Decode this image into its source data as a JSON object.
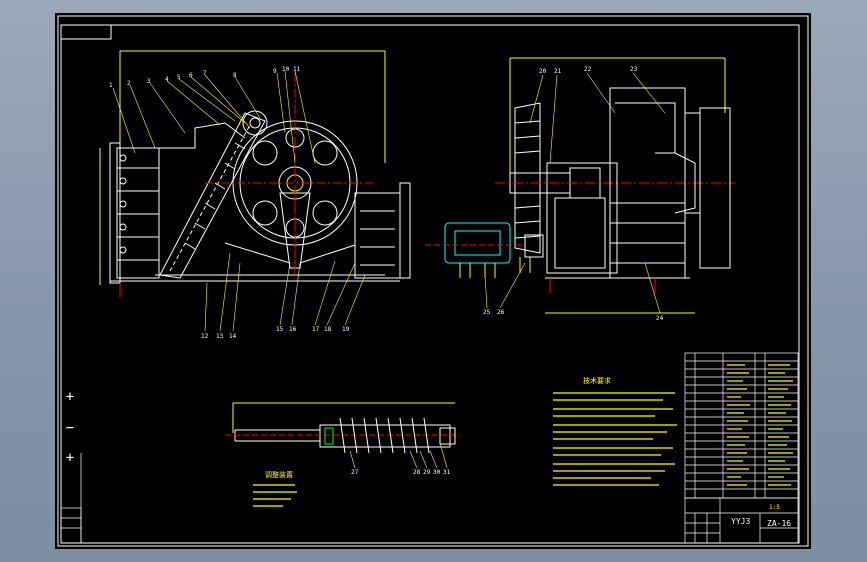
{
  "drawing": {
    "title_block": {
      "drawing_name": "YYJ3",
      "sheet_code": "ZA-16",
      "scale_note": "1:5"
    },
    "main_view_part_numbers": [
      "1",
      "2",
      "3",
      "4",
      "5",
      "6",
      "7",
      "8",
      "9",
      "10",
      "11",
      "12",
      "13",
      "14",
      "15",
      "16",
      "17",
      "18",
      "19"
    ],
    "side_view_part_numbers": [
      "20",
      "21",
      "22",
      "23",
      "24",
      "25",
      "26",
      "27"
    ],
    "detail_part_numbers": [
      "27",
      "28",
      "29",
      "30",
      "31"
    ],
    "notes_heading": "技术要求",
    "detail_caption": "调整装置"
  },
  "colors": {
    "background_desktop": "#8797aa",
    "canvas": "#000000",
    "border": "#ffffff",
    "geometry": "#ffffff",
    "dimension": "#ffff00",
    "annotation": "#ffff00",
    "hatch": "#ff0000",
    "centerline": "#ff0000",
    "motor": "#00ffff"
  },
  "nav_controls": {
    "zoom_in": "+",
    "zoom_out": "−",
    "pan": "+"
  }
}
